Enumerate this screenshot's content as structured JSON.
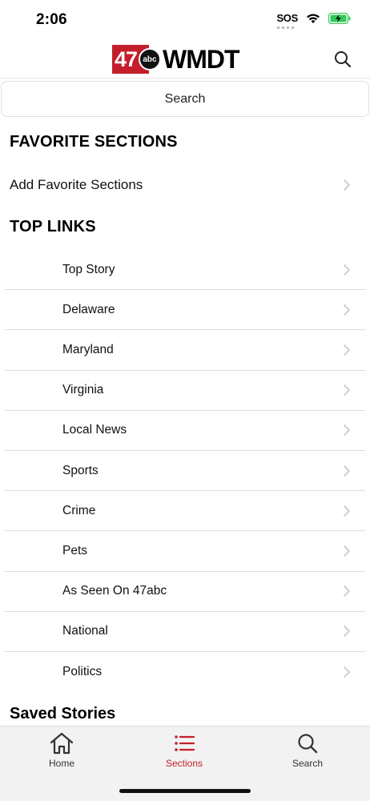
{
  "status_bar": {
    "time": "2:06",
    "sos": "SOS",
    "icons": [
      "wifi-icon",
      "battery-charging-icon"
    ]
  },
  "header": {
    "logo_number": "47",
    "logo_network": "abc",
    "logo_name": "WMDT",
    "search_icon": "search-icon"
  },
  "search": {
    "placeholder": "Search"
  },
  "favorites": {
    "heading": "FAVORITE SECTIONS",
    "add_label": "Add Favorite Sections"
  },
  "top_links": {
    "heading": "TOP LINKS",
    "items": [
      {
        "label": "Top Story"
      },
      {
        "label": "Delaware"
      },
      {
        "label": "Maryland"
      },
      {
        "label": "Virginia"
      },
      {
        "label": "Local News"
      },
      {
        "label": "Sports"
      },
      {
        "label": "Crime"
      },
      {
        "label": "Pets"
      },
      {
        "label": "As Seen On 47abc"
      },
      {
        "label": "National"
      },
      {
        "label": "Politics"
      }
    ]
  },
  "saved": {
    "heading": "Saved Stories"
  },
  "tab_bar": {
    "tabs": [
      {
        "label": "Home",
        "icon": "home-icon"
      },
      {
        "label": "Sections",
        "icon": "list-icon",
        "active": true
      },
      {
        "label": "Search",
        "icon": "search-icon"
      }
    ]
  },
  "colors": {
    "brand_red": "#c41e2a",
    "battery_green": "#34c759"
  }
}
